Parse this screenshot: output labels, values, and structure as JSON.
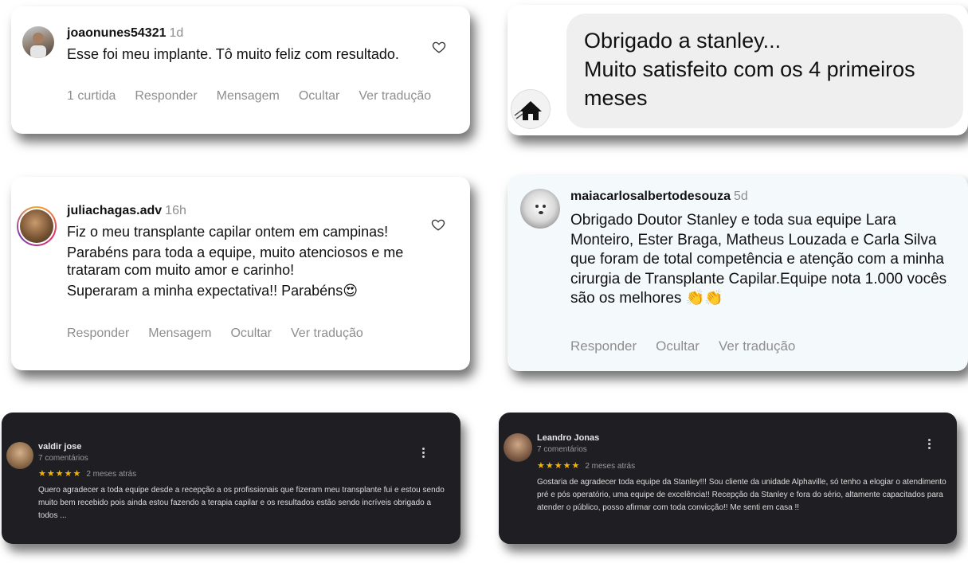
{
  "cards": {
    "c1": {
      "username": "joaonunes54321",
      "time": "1d",
      "text": "Esse foi meu implante. Tô muito feliz com resultado.",
      "actions": [
        "1 curtida",
        "Responder",
        "Mensagem",
        "Ocultar",
        "Ver tradução"
      ]
    },
    "c2": {
      "lines": [
        "Obrigado a stanley...",
        "Muito satisfeito com os 4 primeiros meses"
      ]
    },
    "c3": {
      "username": "juliachagas.adv",
      "time": "16h",
      "paragraphs": [
        "Fiz o meu transplante capilar ontem em campinas!",
        "Parabéns para toda a equipe, muito atenciosos e me trataram com muito amor e carinho!",
        "Superaram a minha expectativa!! Parabéns😍"
      ],
      "actions": [
        "Responder",
        "Mensagem",
        "Ocultar",
        "Ver tradução"
      ]
    },
    "c4": {
      "username": "maiacarlosalbertodesouza",
      "time": "5d",
      "text": "Obrigado Doutor Stanley e toda sua equipe Lara Monteiro, Ester Braga, Matheus Louzada e Carla Silva que foram de total competência e atenção com a minha cirurgia de Transplante Capilar.Equipe nota 1.000 vocês são os melhores 👏👏",
      "actions": [
        "Responder",
        "Ocultar",
        "Ver tradução"
      ]
    },
    "c5": {
      "name": "valdir jose",
      "count": "7 comentários",
      "stars": "★★★★★",
      "rating": 5,
      "date": "2 meses atrás",
      "text": "Quero agradecer a toda equipe  desde a recepção a os profissionais que fizeram meu transplante fui e estou sendo muito bem recebido pois ainda estou fazendo a terapia capilar e os resultados estão sendo incríveis obrigado a todos ..."
    },
    "c6": {
      "name": "Leandro Jonas",
      "count": "7 comentários",
      "stars": "★★★★★",
      "rating": 5,
      "date": "2 meses atrás",
      "text": "Gostaria de agradecer toda equipe da Stanley!!! Sou cliente da unidade Alphaville, só tenho a elogiar o atendimento pré e pós operatório, uma equipe de excelência!! Recepção da Stanley e fora do sério, altamente capacitados para atender o público, posso afirmar com toda convicção!! Me senti em casa !!"
    }
  },
  "colors": {
    "muted": "#8e8e8e",
    "bubble": "#efefef",
    "card4_bg": "#f4f9fc",
    "dark_card": "#1f1f23",
    "star": "#f4b400"
  },
  "icons": [
    "heart-icon",
    "more-vert-icon",
    "avatar"
  ]
}
